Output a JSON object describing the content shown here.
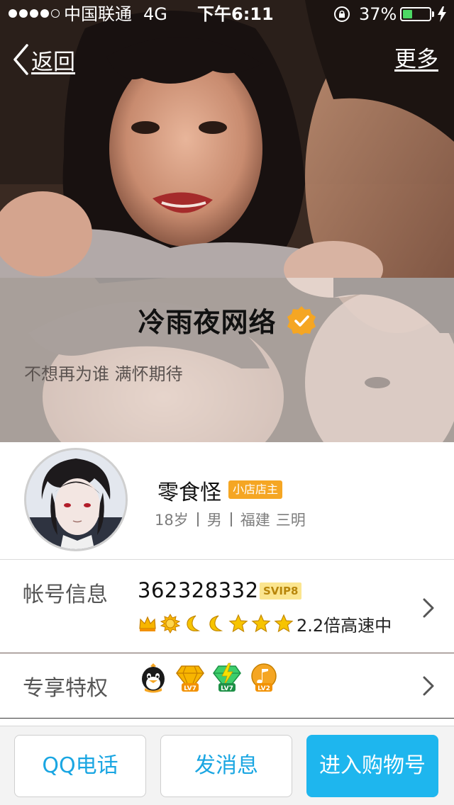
{
  "status_bar": {
    "carrier": "中国联通",
    "network": "4G",
    "time": "下午6:11",
    "battery_percent": "37%",
    "battery_level": 0.37,
    "signal_bars_filled": 4,
    "signal_bars_total": 5
  },
  "nav": {
    "back_label": "返回",
    "more_label": "更多"
  },
  "cover": {
    "nickname": "冷雨夜网络",
    "signature": "不想再为谁 满怀期待",
    "verified_color": "#f5a623"
  },
  "profile": {
    "name": "零食怪",
    "badge": "小店店主",
    "age": "18岁",
    "gender": "男",
    "province": "福建",
    "city": "三明"
  },
  "account": {
    "label": "帐号信息",
    "qq_number": "362328332",
    "vip_badge": "SVIP8",
    "level_icons": [
      "crown-icon",
      "sun-icon",
      "moon-icon",
      "moon-icon",
      "star-icon",
      "star-icon",
      "star-icon"
    ],
    "speed_text": "2.2倍高速中"
  },
  "privileges": {
    "label": "专享特权",
    "icons": [
      {
        "name": "qq-penguin-icon"
      },
      {
        "name": "yellow-diamond-icon",
        "level": "LV7"
      },
      {
        "name": "green-diamond-icon",
        "level": "LV7"
      },
      {
        "name": "music-icon",
        "level": "LV2"
      }
    ]
  },
  "actions": {
    "call": "QQ电话",
    "message": "发消息",
    "shop": "进入购物号"
  },
  "colors": {
    "accent_blue": "#1eb6ee",
    "badge_orange": "#f5a623",
    "battery_green": "#4cd964"
  }
}
